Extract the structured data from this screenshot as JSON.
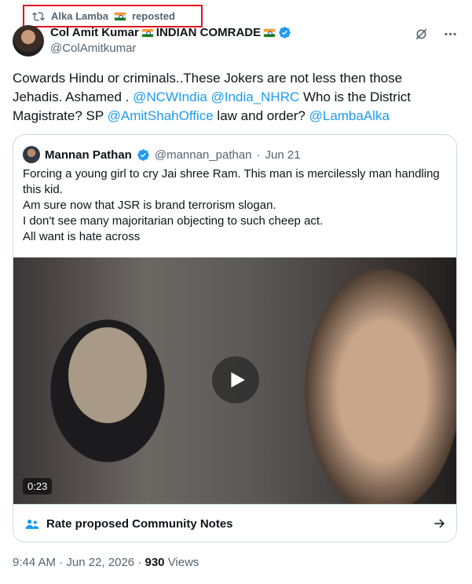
{
  "repost": {
    "name": "Alka Lamba",
    "label": "reposted"
  },
  "author": {
    "name": "Col Amit Kumar",
    "name_suffix": "INDIAN COMRADE",
    "handle": "@ColAmitkumar"
  },
  "tweet": {
    "text_1": "Cowards Hindu or criminals..These Jokers are not less then those Jehadis. Ashamed . ",
    "mention_1": "@NCWIndia",
    "mention_2": "@India_NHRC",
    "text_2": " Who is the District Magistrate? SP ",
    "mention_3": "@AmitShahOffice",
    "text_3": "   law and order? ",
    "mention_4": "@LambaAlka"
  },
  "quote": {
    "name": "Mannan Pathan",
    "handle": "@mannan_pathan",
    "separator": "·",
    "date": "Jun 21",
    "lines": [
      "Forcing a young girl to cry Jai shree Ram. This man is mercilessly man handling this kid.",
      "Am sure now that JSR is brand terrorism slogan.",
      " I don't see many majoritarian objecting to such cheep act.",
      "All want is hate across"
    ],
    "video_duration": "0:23",
    "community_notes_label": "Rate proposed Community Notes"
  },
  "footer": {
    "time": "9:44 AM",
    "date": "Jun 22, 2026",
    "views_count": "930",
    "views_label": "Views"
  },
  "colors": {
    "accent": "#1d9bf0",
    "text": "#0f1419",
    "muted": "#536471",
    "highlight_border": "#e0141e"
  }
}
